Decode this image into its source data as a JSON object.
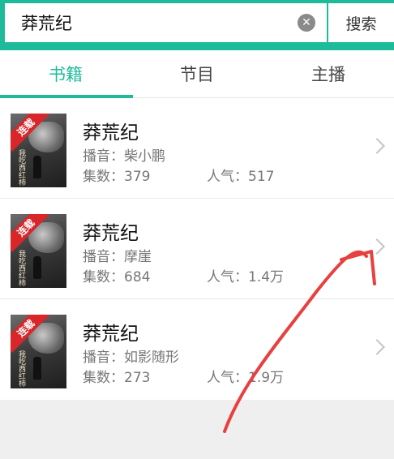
{
  "search": {
    "value": "莽荒纪",
    "clear_icon": "clear-icon",
    "button_label": "搜索"
  },
  "tabs": [
    {
      "label": "书籍",
      "active": true
    },
    {
      "label": "节目",
      "active": false
    },
    {
      "label": "主播",
      "active": false
    }
  ],
  "results": [
    {
      "title": "莽荒纪",
      "anchor_label": "播音：",
      "anchor": "柴小鹏",
      "episodes_label": "集数：",
      "episodes": "379",
      "popularity_label": "人气：",
      "popularity": "517",
      "cover_ribbon": "连载",
      "cover_text": "我吃西红柿"
    },
    {
      "title": "莽荒纪",
      "anchor_label": "播音：",
      "anchor": "摩崖",
      "episodes_label": "集数：",
      "episodes": "684",
      "popularity_label": "人气：",
      "popularity": "1.4万",
      "cover_ribbon": "连载",
      "cover_text": "我吃西红柿"
    },
    {
      "title": "莽荒纪",
      "anchor_label": "播音：",
      "anchor": "如影随形",
      "episodes_label": "集数：",
      "episodes": "273",
      "popularity_label": "人气：",
      "popularity": "1.9万",
      "cover_ribbon": "连载",
      "cover_text": "我吃西红柿"
    }
  ],
  "colors": {
    "accent": "#1dbb9a",
    "ribbon": "#d8262b",
    "annotation": "#e8403f"
  }
}
